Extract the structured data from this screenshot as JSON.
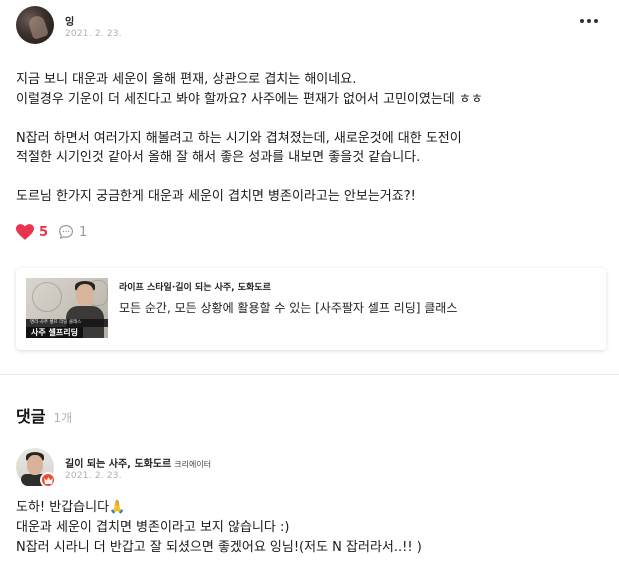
{
  "post": {
    "author": "잉",
    "date": "2021. 2. 23.",
    "paragraphs": [
      "지금 보니 대운과 세운이 올해 편재, 상관으로 겹치는 해이네요.\n이럴경우 기운이 더 세진다고 봐야 할까요? 사주에는 편재가 없어서 고민이였는데 ㅎㅎ",
      "N잡러 하면서 여러가지 해볼려고 하는 시기와 겹쳐졌는데, 새로운것에 대한 도전이\n적절한 시기인것 같아서 올해 잘 해서 좋은 성과를 내보면 좋을것 같습니다.",
      "도르님 한가지 궁금한게 대운과 세운이 겹치면 병존이라고는 안보는거죠?!"
    ],
    "likes": "5",
    "comment_count": "1"
  },
  "class_card": {
    "author": "라이프 스타일·길이 되는 사주, 도화도르",
    "title": "모든 순간, 모든 상황에 활용할 수 있는 [사주팔자 셀프 리딩] 클래스",
    "thumb_title": "사주 셀프리딩",
    "thumb_subtitle": "명리·사주 셀프 리딩 클래스"
  },
  "comments": {
    "title": "댓글",
    "count": "1개",
    "items": [
      {
        "author": "길이 되는 사주, 도화도르",
        "role": "크리에이터",
        "date": "2021. 2. 23.",
        "text": "도하! 반갑습니다🙏\n대운과 세운이 겹치면 병존이라고 보지 않습니다 :)\nN잡러 시라니 더 반갑고 잘 되셨으면 좋겠어요 잉님!(저도 N 잡러라서..!! )"
      }
    ]
  },
  "colors": {
    "like": "#e8344e",
    "badge": "#f04a2a",
    "muted": "#b0b0b0"
  },
  "icons": [
    "more-icon",
    "heart-icon",
    "comment-icon",
    "crown-icon"
  ]
}
